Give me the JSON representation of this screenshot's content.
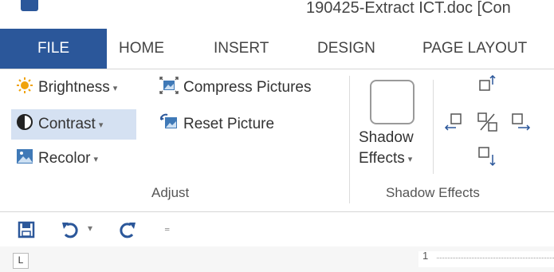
{
  "window": {
    "title": "190425-Extract ICT.doc [Con"
  },
  "tabs": {
    "file": "FILE",
    "home": "HOME",
    "insert": "INSERT",
    "design": "DESIGN",
    "page_layout": "PAGE LAYOUT"
  },
  "adjust_group": {
    "brightness": "Brightness",
    "contrast": "Contrast",
    "recolor": "Recolor",
    "compress_pictures": "Compress Pictures",
    "reset_picture": "Reset Picture",
    "label": "Adjust"
  },
  "shadow_group": {
    "shadow_effects_line1": "Shadow",
    "shadow_effects_line2": "Effects",
    "label": "Shadow Effects"
  },
  "ruler": {
    "tab_marker": "L",
    "number": "1"
  },
  "colors": {
    "accent": "#2b579a",
    "highlight": "#d5e1f2",
    "save_icon": "#2b579a",
    "undo_icon": "#2b579a",
    "brightness_icon": "#f0a30a"
  },
  "icons": [
    "word-app-icon",
    "brightness-icon",
    "contrast-icon",
    "recolor-icon",
    "compress-pictures-icon",
    "reset-picture-icon",
    "shadow-effects-icon",
    "nudge-shadow-up-icon",
    "nudge-shadow-left-icon",
    "shadow-toggle-icon",
    "nudge-shadow-right-icon",
    "nudge-shadow-down-icon",
    "save-icon",
    "undo-icon",
    "redo-icon",
    "customize-qat-icon"
  ]
}
